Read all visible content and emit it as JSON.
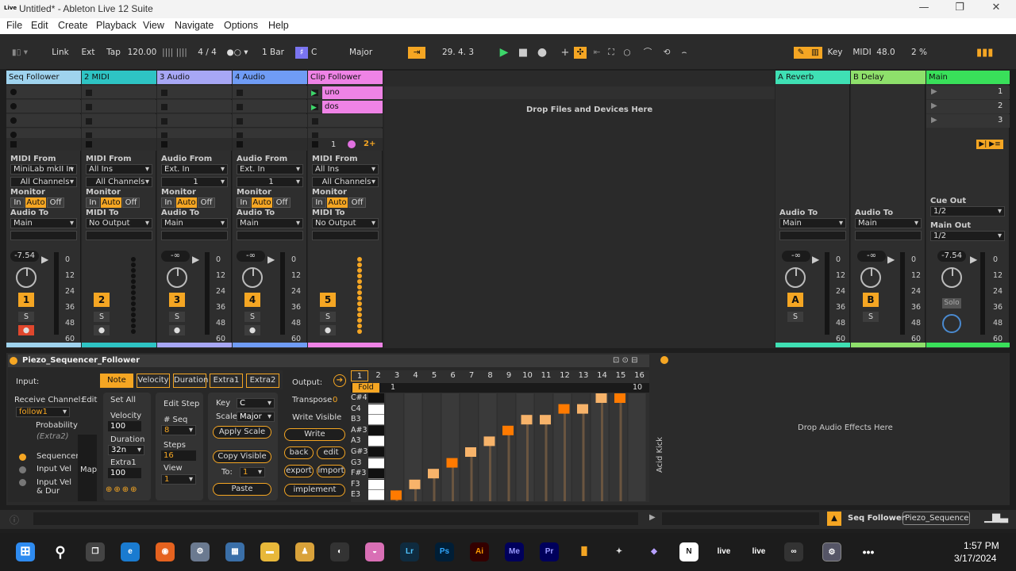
{
  "window": {
    "title": "Untitled* - Ableton Live 12 Suite",
    "logo_text": "Live"
  },
  "menu": [
    "File",
    "Edit",
    "Create",
    "Playback",
    "View",
    "Navigate",
    "Options",
    "Help"
  ],
  "transport": {
    "link": "Link",
    "ext": "Ext",
    "tap": "Tap",
    "tempo": "120.00",
    "signature": "4 / 4",
    "quantize": "1 Bar",
    "key": "C",
    "scale": "Major",
    "position": "29.  4.  3",
    "key_btn": "Key",
    "midi_btn": "MIDI",
    "midi_value": "48.0",
    "cpu": "2 %"
  },
  "tracks": [
    {
      "name": "Seq Follower",
      "color": "#9fd3ee",
      "from_label": "MIDI From",
      "from": "MiniLab mkII In",
      "channel": "All Channels",
      "to_label": "Audio To",
      "to": "Main",
      "vol": "-7.54",
      "num": "1"
    },
    {
      "name": "2 MIDI",
      "color": "#2ec4c4",
      "from_label": "MIDI From",
      "from": "All Ins",
      "channel": "All Channels",
      "to_label": "MIDI To",
      "to": "No Output",
      "vol": "",
      "num": "2"
    },
    {
      "name": "3 Audio",
      "color": "#a7a7f5",
      "from_label": "Audio From",
      "from": "Ext. In",
      "channel": "1",
      "to_label": "Audio To",
      "to": "Main",
      "vol": "-∞",
      "num": "3"
    },
    {
      "name": "4 Audio",
      "color": "#6f9cf5",
      "from_label": "Audio From",
      "from": "Ext. In",
      "channel": "1",
      "to_label": "Audio To",
      "to": "Main",
      "vol": "-∞",
      "num": "4"
    },
    {
      "name": "Clip Follower",
      "color": "#ef83e6",
      "from_label": "MIDI From",
      "from": "All Ins",
      "channel": "All Channels",
      "to_label": "MIDI To",
      "to": "No Output",
      "vol": "",
      "num": "5"
    }
  ],
  "monitor": {
    "label": "Monitor",
    "in": "In",
    "auto": "Auto",
    "off": "Off"
  },
  "clips": [
    "uno",
    "dos"
  ],
  "clip_follower_extra": {
    "count": "1",
    "badge": "2+"
  },
  "drop_files": "Drop Files and Devices Here",
  "returns": [
    {
      "name": "A Reverb",
      "color": "#3fe0b4",
      "letter": "A",
      "to_label": "Audio To",
      "to": "Main",
      "vol": "-∞"
    },
    {
      "name": "B Delay",
      "color": "#8ee06b",
      "letter": "B",
      "to_label": "Audio To",
      "to": "Main",
      "vol": "-∞"
    }
  ],
  "main": {
    "name": "Main",
    "color": "#39e05a",
    "cue_label": "Cue Out",
    "cue": "1/2",
    "out_label": "Main Out",
    "out": "1/2",
    "vol": "-7.54",
    "solo": "Solo",
    "scenes": [
      "1",
      "2",
      "3"
    ]
  },
  "scale_marks": [
    "0",
    "12",
    "24",
    "36",
    "48",
    "60"
  ],
  "solo_label": "S",
  "device": {
    "name": "Piezo_Sequencer_Follower",
    "input_label": "Input:",
    "receive_label": "Receive Channel:",
    "receive": "follow1",
    "edit": "Edit",
    "probability": "Probability",
    "extra2": "(Extra2)",
    "modes": [
      "Sequencer",
      "Input Vel",
      "Input Vel & Dur"
    ],
    "map": "Map",
    "tabs": [
      "Note",
      "Velocity",
      "Duration",
      "Extra1",
      "Extra2"
    ],
    "set_all": "Set All",
    "velocity_label": "Velocity",
    "velocity": "100",
    "duration_label": "Duration",
    "duration": "32n",
    "extra1_label": "Extra1",
    "extra1": "100",
    "edit_step": "Edit Step",
    "seq_label": "# Seq",
    "seq": "8",
    "steps_label": "Steps",
    "steps": "16",
    "view_label": "View",
    "view": "1",
    "key_label": "Key",
    "key": "C",
    "scale_label": "Scale",
    "scale": "Major",
    "apply_scale": "Apply Scale",
    "copy_visible": "Copy Visible",
    "to_label": "To:",
    "to": "1",
    "paste": "Paste",
    "output_label": "Output:",
    "transpose_label": "Transpose",
    "transpose": "0",
    "write_visible": "Write Visible",
    "write": "Write",
    "back": "back",
    "edit_btn": "edit",
    "export": "export",
    "import": "import",
    "implement": "implement",
    "steps_header": [
      "1",
      "2",
      "3",
      "4",
      "5",
      "6",
      "7",
      "8",
      "9",
      "10",
      "11",
      "12",
      "13",
      "14",
      "15",
      "16"
    ],
    "fold": "Fold",
    "bar_start": "1",
    "bar_end": "10",
    "notes": [
      "C#4",
      "C4",
      "B3",
      "A#3",
      "A3",
      "G#3",
      "G3",
      "F#3",
      "F3",
      "E3"
    ],
    "side_label": "Acid Kick"
  },
  "drop_audio": "Drop Audio Effects Here",
  "status": {
    "track": "Seq Follower",
    "device": "Piezo_Sequence"
  },
  "clock": {
    "time": "1:57 PM",
    "date": "3/17/2024"
  },
  "taskbar_labels": {
    "lr": "Lr",
    "ps": "Ps",
    "ai": "Ai",
    "me": "Me",
    "pr": "Pr",
    "live1": "live",
    "live2": "live"
  }
}
